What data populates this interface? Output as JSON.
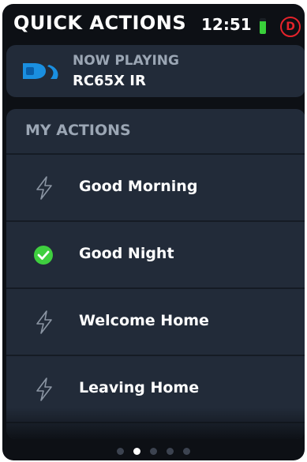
{
  "header": {
    "title": "QUICK ACTIONS",
    "time": "12:51",
    "battery_level": 0.8,
    "profile_initial": "D"
  },
  "now_playing": {
    "label": "NOW PLAYING",
    "device": "RC65X IR",
    "logo_icon": "directv-logo-icon"
  },
  "actions": {
    "title": "MY ACTIONS",
    "items": [
      {
        "label": "Good Morning",
        "icon": "lightning-bolt-icon",
        "active": false
      },
      {
        "label": "Good Night",
        "icon": "check-circle-icon",
        "active": true
      },
      {
        "label": "Welcome Home",
        "icon": "lightning-bolt-icon",
        "active": false
      },
      {
        "label": "Leaving Home",
        "icon": "lightning-bolt-icon",
        "active": false
      }
    ]
  },
  "pagination": {
    "total": 5,
    "current": 2
  },
  "colors": {
    "background": "#0d1015",
    "panel": "#222b39",
    "accent_blue": "#1a8fe0",
    "success_green": "#3fcf3f",
    "profile_red": "#e5232b"
  }
}
